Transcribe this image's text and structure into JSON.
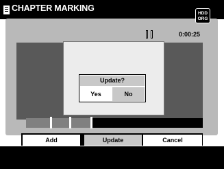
{
  "header": {
    "title": "CHAPTER MARKING",
    "badge_line1": "HDD",
    "badge_line2": "ORG"
  },
  "player": {
    "state": "paused",
    "timecode": "0:00:25"
  },
  "dialog": {
    "title": "Update?",
    "yes_label": "Yes",
    "no_label": "No",
    "selected": "Yes"
  },
  "timeline": {
    "marked_fraction": 0.37,
    "chapter_marks": [
      0.14,
      0.25,
      0.37
    ]
  },
  "buttons": {
    "add_label": "Add",
    "update_label": "Update",
    "cancel_label": "Cancel",
    "selected": "Update"
  },
  "colors": {
    "header_bg": "#000000",
    "panel_bg": "#b9b9b9",
    "video_bg": "#595959",
    "highlight": "#c8c8c8"
  }
}
